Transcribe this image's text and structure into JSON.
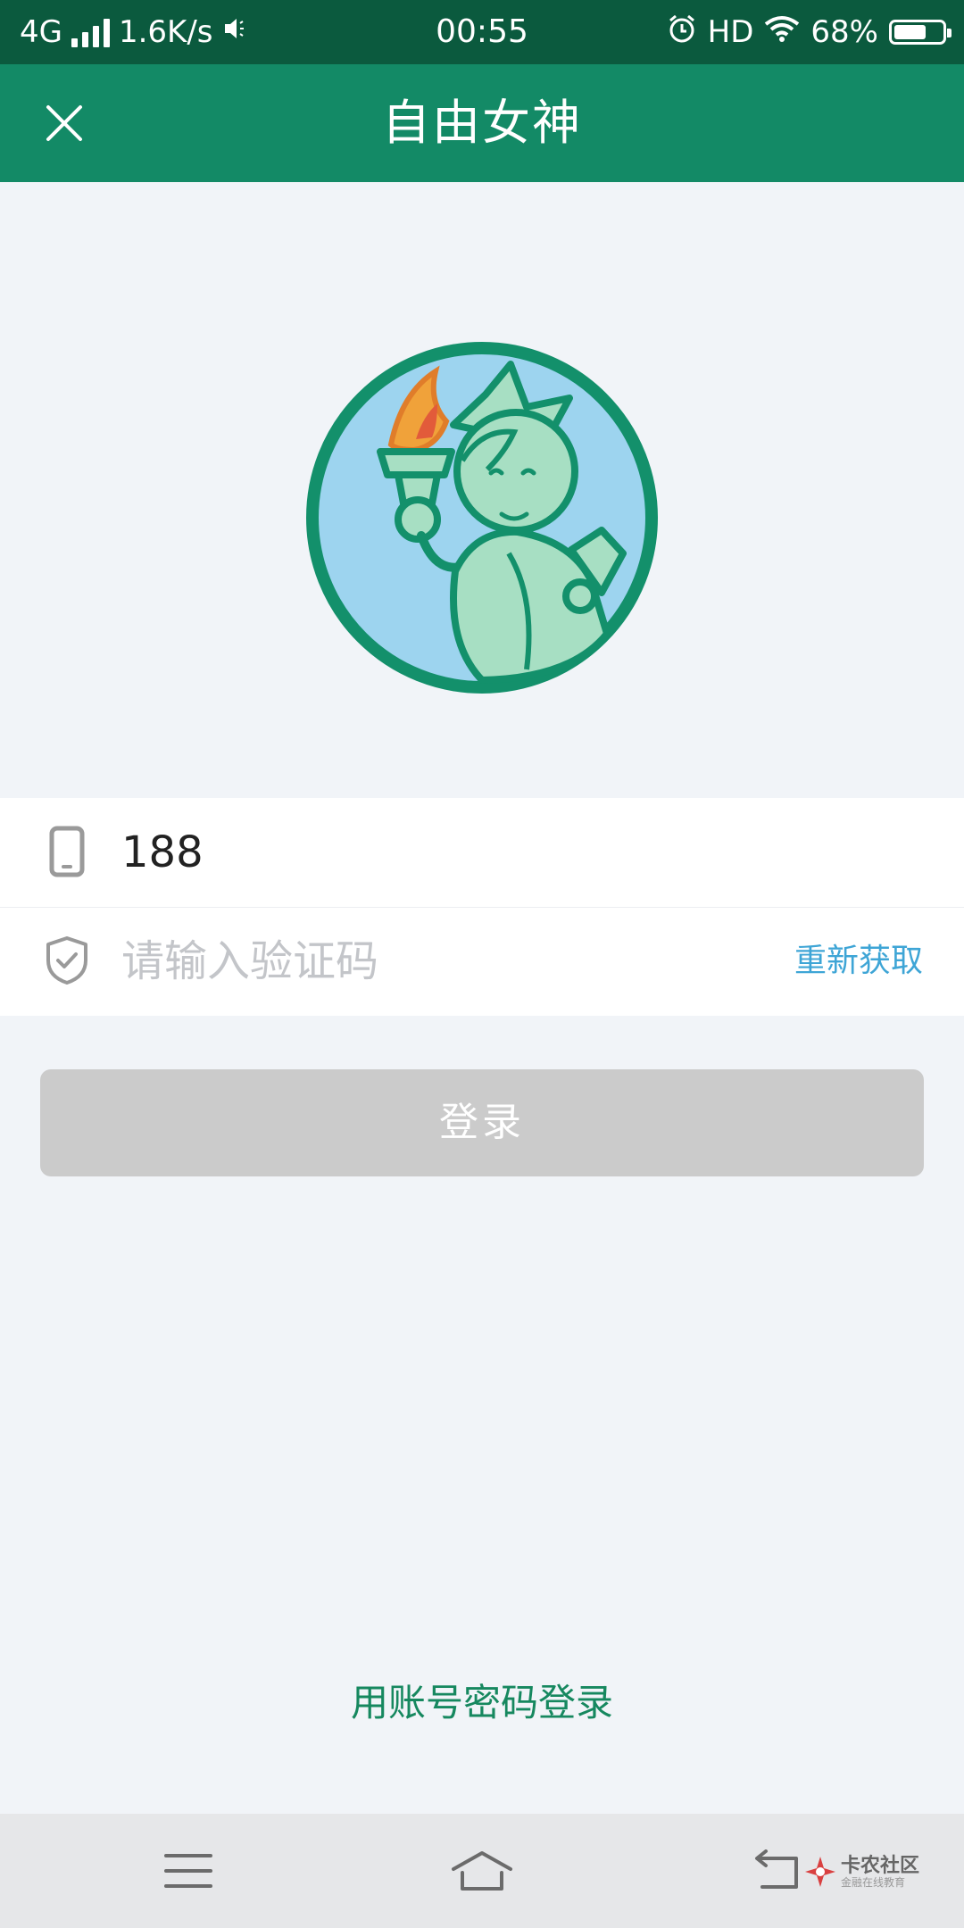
{
  "status_bar": {
    "network": "4G",
    "speed": "1.6K/s",
    "time": "00:55",
    "hd": "HD",
    "battery_percent": "68%",
    "battery_level": 0.68
  },
  "header": {
    "title": "自由女神"
  },
  "login_form": {
    "phone_value": "188",
    "code_placeholder": "请输入验证码",
    "resend_label": "重新获取",
    "login_label": "登录",
    "alt_login_label": "用账号密码登录"
  },
  "watermark": {
    "name": "卡农社区",
    "tagline": "金融在线教育"
  },
  "colors": {
    "status_bar": "#0b5a3e",
    "title_bar": "#138a66",
    "accent_link": "#3ea5d6",
    "alt_link": "#16885f",
    "button_disabled": "#cbcbcb",
    "background": "#f1f4f8"
  },
  "icons": {
    "close": "close-icon",
    "phone": "phone-icon",
    "shield": "shield-check-icon",
    "menu": "menu-icon",
    "home": "home-icon",
    "back": "back-icon"
  }
}
